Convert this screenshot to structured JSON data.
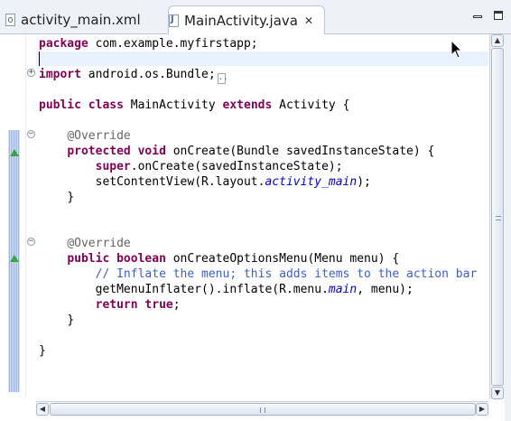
{
  "tabs": [
    {
      "label": "activity_main.xml",
      "icon": "xml-file-icon",
      "active": false
    },
    {
      "label": "MainActivity.java",
      "icon": "java-file-icon",
      "active": true,
      "close": "✕"
    }
  ],
  "window_controls": {
    "minimize": "minimize-icon",
    "maximize": "maximize-icon"
  },
  "code": {
    "package_kw": "package",
    "package_name": "com.example.myfirstapp;",
    "import_kw": "import",
    "import_name": "android.os.Bundle;",
    "import_fold": "..",
    "public_kw": "public",
    "class_kw": "class",
    "class_name": "MainActivity",
    "extends_kw": "extends",
    "base_class": "Activity {",
    "override1": "@Override",
    "protected_kw": "protected",
    "void_kw": "void",
    "oncreate_sig": "onCreate(Bundle savedInstanceState) {",
    "super_kw": "super",
    "super_call": ".onCreate(savedInstanceState);",
    "setcontent_prefix": "setContentView(R.layout.",
    "setcontent_field": "activity_main",
    "setcontent_suffix": ");",
    "close_brace1": "}",
    "override2": "@Override",
    "public2_kw": "public",
    "boolean_kw": "boolean",
    "menu_sig": "onCreateOptionsMenu(Menu menu) {",
    "comment": "// Inflate the menu; this adds items to the action bar",
    "inflate_prefix": "getMenuInflater().inflate(R.menu.",
    "inflate_field": "main",
    "inflate_suffix": ", menu);",
    "return_kw": "return",
    "true_kw": "true",
    "return_end": ";",
    "close_brace2": "}",
    "close_brace3": "}"
  },
  "colors": {
    "keyword": "#7f0055",
    "annotation": "#646464",
    "field": "#0000c0",
    "comment": "#3f5fbf",
    "current_line": "#e8f2fe"
  },
  "scrollbars": {
    "up": "▲",
    "down": "▼",
    "left": "◀",
    "right": "▶"
  }
}
